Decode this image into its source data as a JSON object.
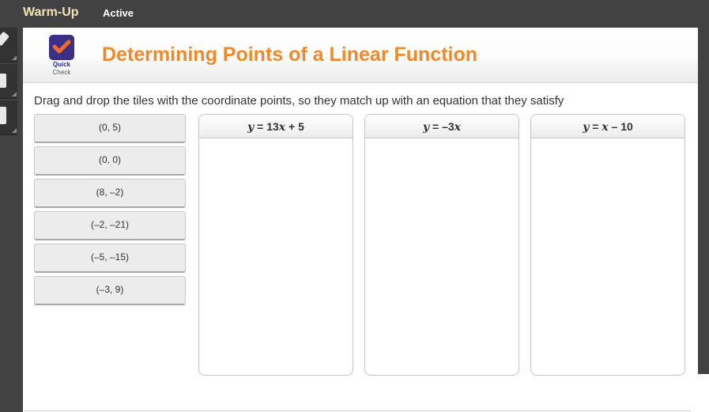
{
  "topbar": {
    "course_label": "Warm-Up",
    "status_label": "Active"
  },
  "left_tools": [
    {
      "name": "pencil-tool"
    },
    {
      "name": "calculator-tool"
    },
    {
      "name": "formula-tool"
    }
  ],
  "header": {
    "logo_line1": "Quick",
    "logo_line2": "Check",
    "title": "Determining Points of a Linear Function"
  },
  "instructions": "Drag and drop the tiles with the coordinate points, so they match up with an equation that they satisfy",
  "tiles": [
    {
      "label": "(0, 5)"
    },
    {
      "label": "(0, 0)"
    },
    {
      "label": "(8, –2)"
    },
    {
      "label": "(–2, –21)"
    },
    {
      "label": "(–5, –15)"
    },
    {
      "label": "(–3, 9)"
    }
  ],
  "drop_zones": [
    {
      "equation_var": "y",
      "equation_rest": " = 13",
      "equation_x": "x",
      "equation_tail": " + 5"
    },
    {
      "equation_var": "y",
      "equation_rest": " = –3",
      "equation_x": "x",
      "equation_tail": ""
    },
    {
      "equation_var": "y",
      "equation_rest": " = ",
      "equation_x": "x",
      "equation_tail": " – 10"
    }
  ],
  "colors": {
    "title_orange": "#f0892b",
    "chrome_dark": "#424242",
    "course_label": "#f3e3b3",
    "logo_purple": "#3b2f86"
  }
}
